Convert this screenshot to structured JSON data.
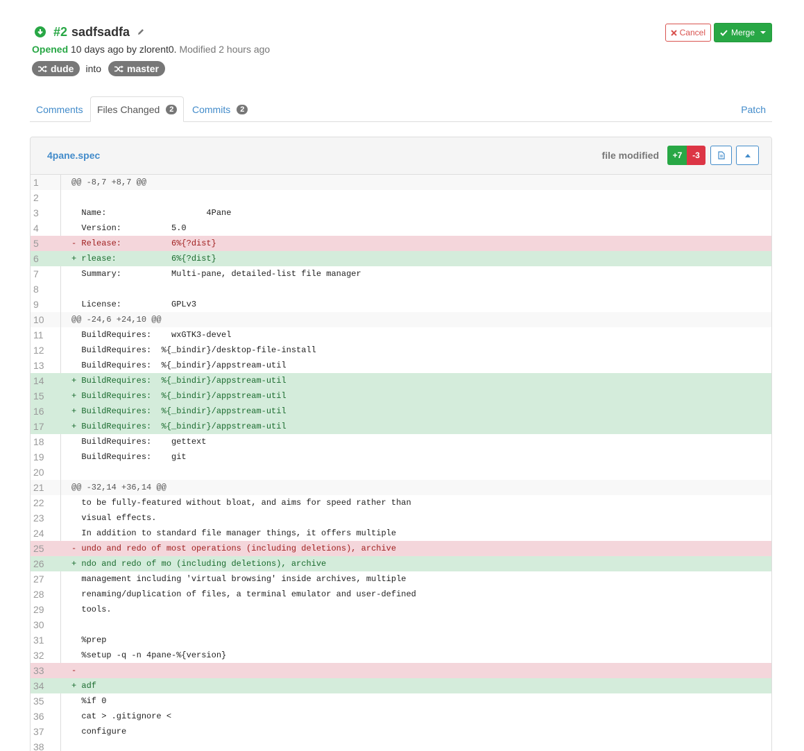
{
  "pr": {
    "number": "#2",
    "title": "sadfsadfa",
    "status": "Opened",
    "opened_text": "10 days ago by zlorent0.",
    "modified_text": "Modified 2 hours ago",
    "source_branch": "dude",
    "into_text": "into",
    "target_branch": "master"
  },
  "actions": {
    "cancel_label": "Cancel",
    "merge_label": "Merge"
  },
  "colors": {
    "accent": "#428bca",
    "success": "#28a745",
    "danger": "#dc3545"
  },
  "tabs": {
    "comments": "Comments",
    "files_changed": "Files Changed",
    "files_changed_count": "2",
    "commits": "Commits",
    "commits_count": "2",
    "patch": "Patch"
  },
  "file": {
    "name": "4pane.spec",
    "status": "file modified",
    "additions": "+7",
    "deletions": "-3"
  },
  "diff": [
    {
      "n": "1",
      "t": "hunk",
      "c": "@@ -8,7 +8,7 @@"
    },
    {
      "n": "2",
      "t": "ctx",
      "c": ""
    },
    {
      "n": "3",
      "t": "ctx",
      "c": "  Name:                    4Pane"
    },
    {
      "n": "4",
      "t": "ctx",
      "c": "  Version:          5.0"
    },
    {
      "n": "5",
      "t": "del",
      "c": "- Release:          6%{?dist}"
    },
    {
      "n": "6",
      "t": "add",
      "c": "+ rlease:           6%{?dist}"
    },
    {
      "n": "7",
      "t": "ctx",
      "c": "  Summary:          Multi-pane, detailed-list file manager"
    },
    {
      "n": "8",
      "t": "ctx",
      "c": ""
    },
    {
      "n": "9",
      "t": "ctx",
      "c": "  License:          GPLv3"
    },
    {
      "n": "10",
      "t": "hunk",
      "c": "@@ -24,6 +24,10 @@"
    },
    {
      "n": "11",
      "t": "ctx",
      "c": "  BuildRequires:    wxGTK3-devel"
    },
    {
      "n": "12",
      "t": "ctx",
      "c": "  BuildRequires:  %{_bindir}/desktop-file-install"
    },
    {
      "n": "13",
      "t": "ctx",
      "c": "  BuildRequires:  %{_bindir}/appstream-util"
    },
    {
      "n": "14",
      "t": "add",
      "c": "+ BuildRequires:  %{_bindir}/appstream-util"
    },
    {
      "n": "15",
      "t": "add",
      "c": "+ BuildRequires:  %{_bindir}/appstream-util"
    },
    {
      "n": "16",
      "t": "add",
      "c": "+ BuildRequires:  %{_bindir}/appstream-util"
    },
    {
      "n": "17",
      "t": "add",
      "c": "+ BuildRequires:  %{_bindir}/appstream-util"
    },
    {
      "n": "18",
      "t": "ctx",
      "c": "  BuildRequires:    gettext"
    },
    {
      "n": "19",
      "t": "ctx",
      "c": "  BuildRequires:    git"
    },
    {
      "n": "20",
      "t": "ctx",
      "c": ""
    },
    {
      "n": "21",
      "t": "hunk",
      "c": "@@ -32,14 +36,14 @@"
    },
    {
      "n": "22",
      "t": "ctx",
      "c": "  to be fully-featured without bloat, and aims for speed rather than"
    },
    {
      "n": "23",
      "t": "ctx",
      "c": "  visual effects."
    },
    {
      "n": "24",
      "t": "ctx",
      "c": "  In addition to standard file manager things, it offers multiple"
    },
    {
      "n": "25",
      "t": "del",
      "c": "- undo and redo of most operations (including deletions), archive"
    },
    {
      "n": "26",
      "t": "add",
      "c": "+ ndo and redo of mo (including deletions), archive"
    },
    {
      "n": "27",
      "t": "ctx",
      "c": "  management including 'virtual browsing' inside archives, multiple"
    },
    {
      "n": "28",
      "t": "ctx",
      "c": "  renaming/duplication of files, a terminal emulator and user-defined"
    },
    {
      "n": "29",
      "t": "ctx",
      "c": "  tools."
    },
    {
      "n": "30",
      "t": "ctx",
      "c": ""
    },
    {
      "n": "31",
      "t": "ctx",
      "c": "  %prep"
    },
    {
      "n": "32",
      "t": "ctx",
      "c": "  %setup -q -n 4pane-%{version}"
    },
    {
      "n": "33",
      "t": "del",
      "c": "-"
    },
    {
      "n": "34",
      "t": "add",
      "c": "+ adf"
    },
    {
      "n": "35",
      "t": "ctx",
      "c": "  %if 0"
    },
    {
      "n": "36",
      "t": "ctx",
      "c": "  cat > .gitignore <"
    },
    {
      "n": "37",
      "t": "ctx",
      "c": "  configure"
    },
    {
      "n": "38",
      "t": "ctx",
      "c": ""
    }
  ]
}
